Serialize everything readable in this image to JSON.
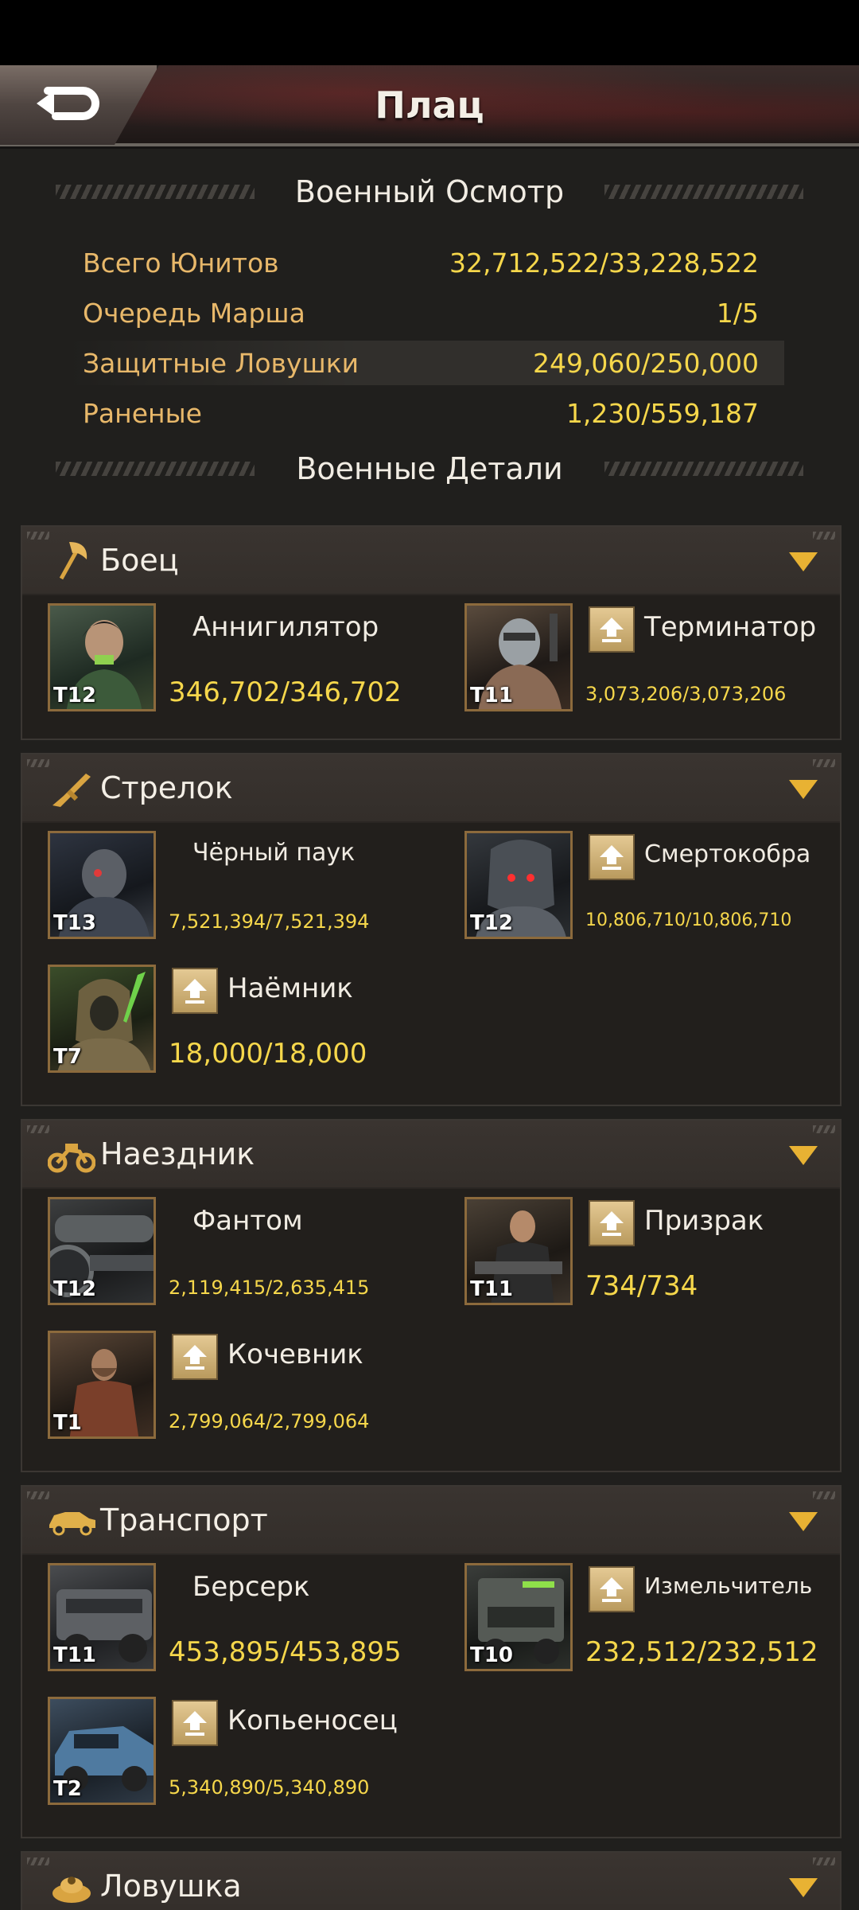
{
  "header": {
    "title": "Плац",
    "back_icon": "back-arrow-icon"
  },
  "overview": {
    "title": "Военный Осмотр",
    "rows": [
      {
        "label": "Всего Юнитов",
        "value": "32,712,522/33,228,522"
      },
      {
        "label": "Очередь Марша",
        "value": "1/5"
      },
      {
        "label": "Защитные Ловушки",
        "value": "249,060/250,000"
      },
      {
        "label": "Раненые",
        "value": "1,230/559,187"
      }
    ]
  },
  "details": {
    "title": "Военные Детали"
  },
  "categories": [
    {
      "title": "Боец",
      "icon": "axe-icon",
      "units": [
        {
          "name": "Аннигилятор",
          "tier": "T12",
          "count": "346,702/346,702",
          "upgradable": false
        },
        {
          "name": "Терминатор",
          "tier": "T11",
          "count": "3,073,206/3,073,206",
          "upgradable": true
        }
      ]
    },
    {
      "title": "Стрелок",
      "icon": "rifle-icon",
      "units": [
        {
          "name": "Чёрный паук",
          "tier": "T13",
          "count": "7,521,394/7,521,394",
          "upgradable": false
        },
        {
          "name": "Смертокобра",
          "tier": "T12",
          "count": "10,806,710/10,806,710",
          "upgradable": true
        },
        {
          "name": "Наёмник",
          "tier": "T7",
          "count": "18,000/18,000",
          "upgradable": true
        }
      ]
    },
    {
      "title": "Наездник",
      "icon": "motorcycle-icon",
      "units": [
        {
          "name": "Фантом",
          "tier": "T12",
          "count": "2,119,415/2,635,415",
          "upgradable": false
        },
        {
          "name": "Призрак",
          "tier": "T11",
          "count": "734/734",
          "upgradable": true
        },
        {
          "name": "Кочевник",
          "tier": "T1",
          "count": "2,799,064/2,799,064",
          "upgradable": true
        }
      ]
    },
    {
      "title": "Транспорт",
      "icon": "car-icon",
      "units": [
        {
          "name": "Берсерк",
          "tier": "T11",
          "count": "453,895/453,895",
          "upgradable": false
        },
        {
          "name": "Измельчитель",
          "tier": "T10",
          "count": "232,512/232,512",
          "upgradable": true
        },
        {
          "name": "Копьеносец",
          "tier": "T2",
          "count": "5,340,890/5,340,890",
          "upgradable": true
        }
      ]
    },
    {
      "title": "Ловушка",
      "icon": "mine-icon",
      "units": []
    }
  ],
  "colors": {
    "accent_gold": "#f6d74b",
    "label_orange": "#e8b86a",
    "chevron": "#e8b233"
  }
}
